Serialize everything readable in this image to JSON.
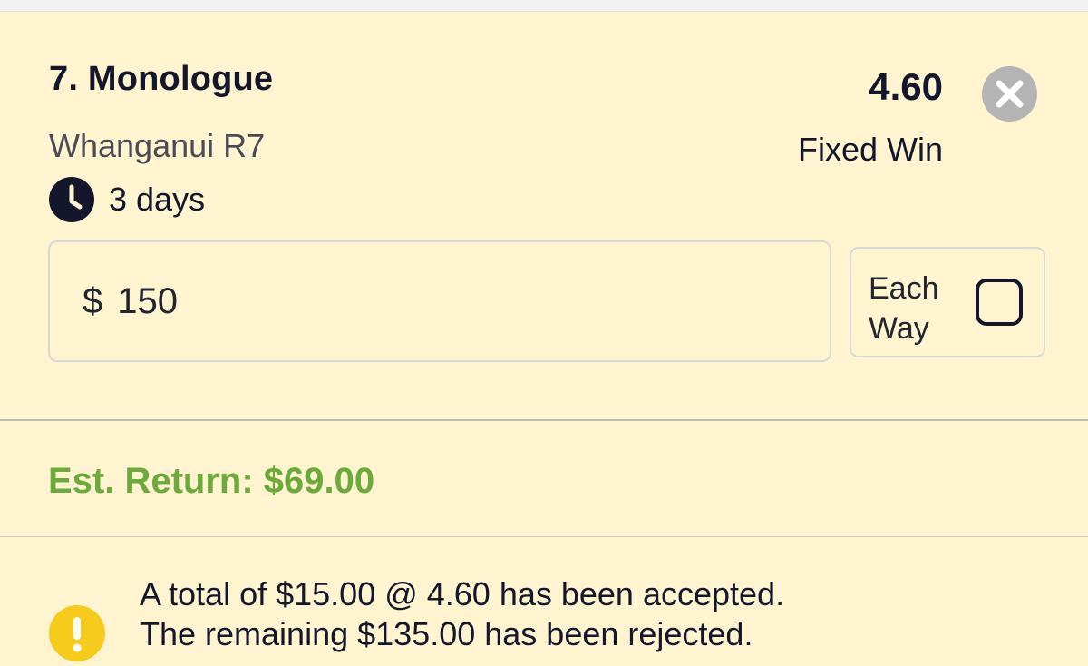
{
  "selection": {
    "title": "7. Monologue",
    "venue": "Whanganui R7",
    "time_remaining": "3 days",
    "odds": "4.60",
    "bet_type": "Fixed Win"
  },
  "stake": {
    "currency_symbol": "$",
    "value": "150"
  },
  "each_way": {
    "label": "Each Way",
    "checked": false
  },
  "estimate": {
    "text": "Est. Return: $69.00"
  },
  "message": {
    "line1": "A total of $15.00 @ 4.60 has been accepted.",
    "line2": "The remaining $135.00 has been rejected."
  },
  "icons": {
    "close": "close-icon",
    "clock": "clock-icon",
    "warning": "warning-icon"
  },
  "colors": {
    "background": "#FFF4D0",
    "text": "#14172B",
    "est_return": "#6DAA3C",
    "warning": "#F6CB1C",
    "close_button": "#B4B4B4"
  }
}
